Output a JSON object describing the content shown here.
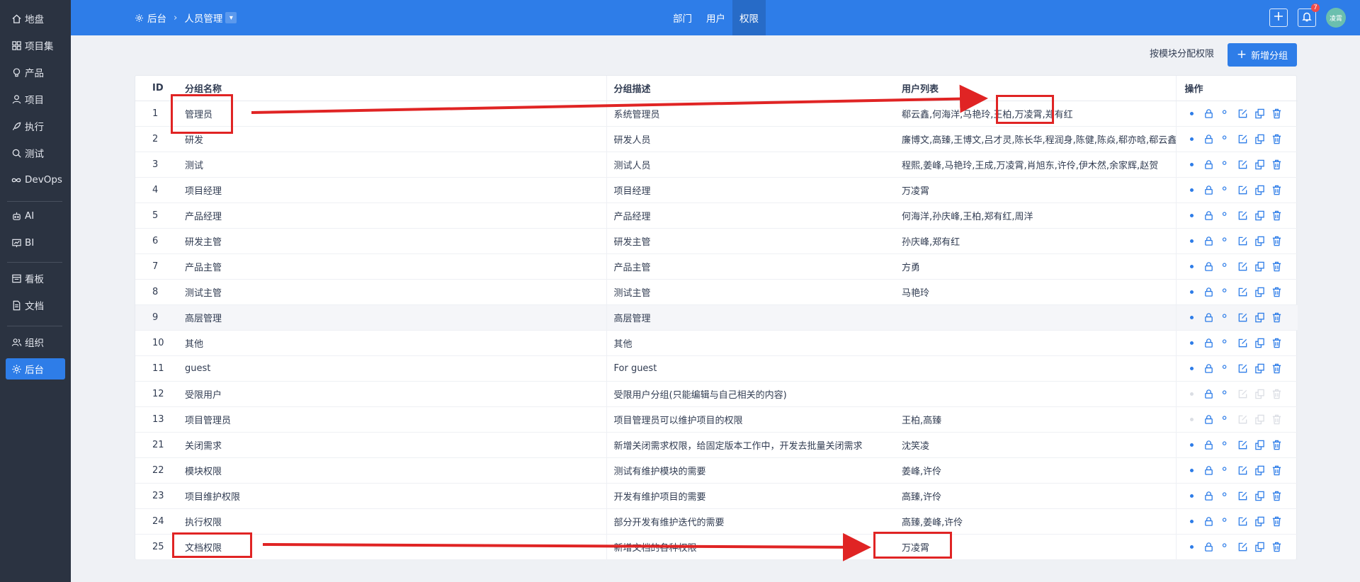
{
  "sidebar": {
    "items": [
      {
        "label": "地盘",
        "icon": "home-icon"
      },
      {
        "label": "项目集",
        "icon": "grid-icon"
      },
      {
        "label": "产品",
        "icon": "lightbulb-icon"
      },
      {
        "label": "项目",
        "icon": "user-icon"
      },
      {
        "label": "执行",
        "icon": "rocket-icon"
      },
      {
        "label": "测试",
        "icon": "search-icon"
      },
      {
        "label": "DevOps",
        "icon": "infinity-icon"
      },
      {
        "label": "AI",
        "icon": "robot-icon"
      },
      {
        "label": "BI",
        "icon": "chart-icon"
      },
      {
        "label": "看板",
        "icon": "board-icon"
      },
      {
        "label": "文档",
        "icon": "document-icon"
      },
      {
        "label": "组织",
        "icon": "users-icon"
      },
      {
        "label": "后台",
        "icon": "gear-icon",
        "active": true
      }
    ]
  },
  "header": {
    "breadcrumb_root": "后台",
    "breadcrumb_current": "人员管理",
    "tabs": [
      {
        "label": "部门"
      },
      {
        "label": "用户"
      },
      {
        "label": "权限",
        "active": true
      }
    ],
    "notification_count": "7",
    "avatar_text": "凌霄"
  },
  "toolbar": {
    "assign_label": "按模块分配权限",
    "new_group_label": "新增分组"
  },
  "table": {
    "columns": [
      "ID",
      "分组名称",
      "分组描述",
      "用户列表",
      "操作"
    ],
    "rows": [
      {
        "id": "1",
        "name": "管理员",
        "desc": "系统管理员",
        "users": "郗云鑫,何海洋,马艳玲,王柏,万凌霄,郑有红"
      },
      {
        "id": "2",
        "name": "研发",
        "desc": "研发人员",
        "users": "廉博文,高臻,王博文,吕才灵,陈长华,程润身,陈健,陈焱,郗亦晗,郗云鑫,方"
      },
      {
        "id": "3",
        "name": "测试",
        "desc": "测试人员",
        "users": "程熙,姜峰,马艳玲,王成,万凌霄,肖旭东,许伶,伊木然,余家辉,赵贺"
      },
      {
        "id": "4",
        "name": "项目经理",
        "desc": "项目经理",
        "users": "万凌霄"
      },
      {
        "id": "5",
        "name": "产品经理",
        "desc": "产品经理",
        "users": "何海洋,孙庆峰,王柏,郑有红,周洋"
      },
      {
        "id": "6",
        "name": "研发主管",
        "desc": "研发主管",
        "users": "孙庆峰,郑有红"
      },
      {
        "id": "7",
        "name": "产品主管",
        "desc": "产品主管",
        "users": "方勇"
      },
      {
        "id": "8",
        "name": "测试主管",
        "desc": "测试主管",
        "users": "马艳玲"
      },
      {
        "id": "9",
        "name": "高层管理",
        "desc": "高层管理",
        "users": "",
        "highlight": true
      },
      {
        "id": "10",
        "name": "其他",
        "desc": "其他",
        "users": ""
      },
      {
        "id": "11",
        "name": "guest",
        "desc": "For guest",
        "users": ""
      },
      {
        "id": "12",
        "name": "受限用户",
        "desc": "受限用户分组(只能编辑与自己相关的内容)",
        "users": "",
        "disabled": true
      },
      {
        "id": "13",
        "name": "项目管理员",
        "desc": "项目管理员可以维护项目的权限",
        "users": "王柏,高臻",
        "disabled": true
      },
      {
        "id": "21",
        "name": "关闭需求",
        "desc": "新增关闭需求权限，给固定版本工作中，开发去批量关闭需求",
        "users": "沈笑凌"
      },
      {
        "id": "22",
        "name": "模块权限",
        "desc": "测试有维护模块的需要",
        "users": "姜峰,许伶"
      },
      {
        "id": "23",
        "name": "项目维护权限",
        "desc": "开发有维护项目的需要",
        "users": "高臻,许伶"
      },
      {
        "id": "24",
        "name": "执行权限",
        "desc": "部分开发有维护迭代的需要",
        "users": "高臻,姜峰,许伶"
      },
      {
        "id": "25",
        "name": "文档权限",
        "desc": "新增文档的各种权限",
        "users": "万凌霄"
      }
    ],
    "action_icons": [
      "eye-icon",
      "lock-icon",
      "user-group-icon",
      "edit-icon",
      "copy-icon",
      "trash-icon"
    ]
  },
  "colors": {
    "brand": "#2e7de8",
    "sidebar": "#2b3341",
    "annotation": "#e02424"
  }
}
